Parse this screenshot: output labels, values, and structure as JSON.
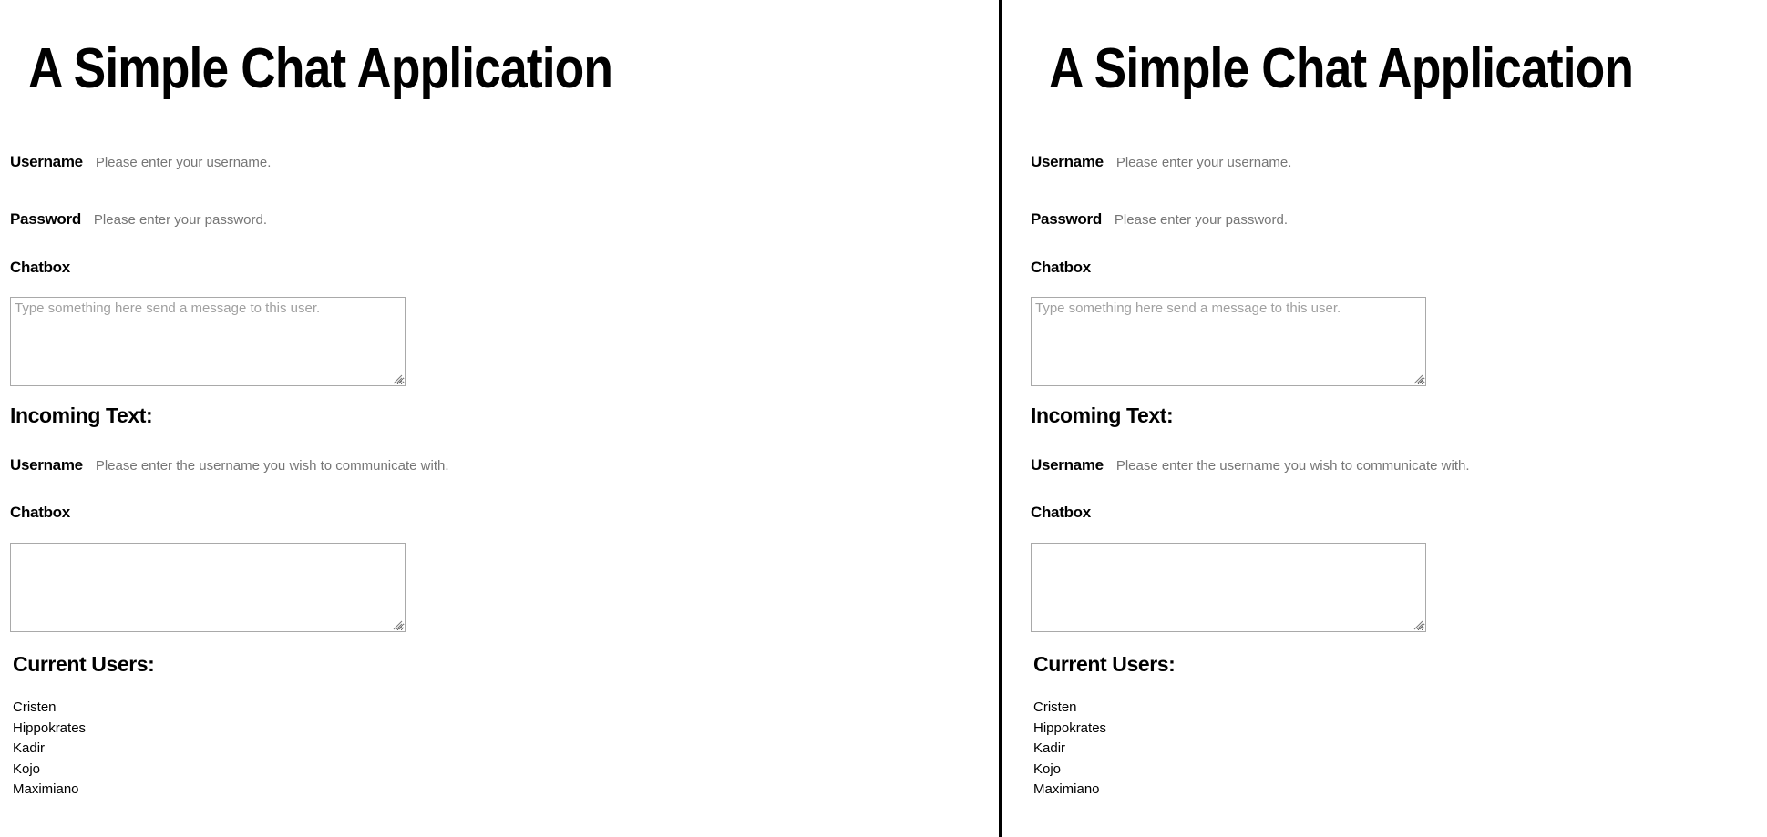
{
  "app": {
    "title": "A Simple Chat Application"
  },
  "login": {
    "username_label": "Username",
    "username_placeholder": "Please enter your username.",
    "password_label": "Password",
    "password_placeholder": "Please enter your password."
  },
  "outgoing": {
    "chatbox_label": "Chatbox",
    "chatbox_placeholder": "Type something here send a message to this user."
  },
  "incoming": {
    "heading": "Incoming Text:",
    "username_label": "Username",
    "username_placeholder": "Please enter the username you wish to communicate with.",
    "chatbox_label": "Chatbox"
  },
  "users": {
    "heading": "Current Users:",
    "list": [
      "Cristen",
      "Hippokrates",
      "Kadir",
      "Kojo",
      "Maximiano"
    ]
  },
  "icons": {
    "resize_grip": "resize-grip-icon"
  },
  "colors": {
    "divider": "#000000",
    "border": "#a9a9a9",
    "placeholder": "#767676"
  }
}
